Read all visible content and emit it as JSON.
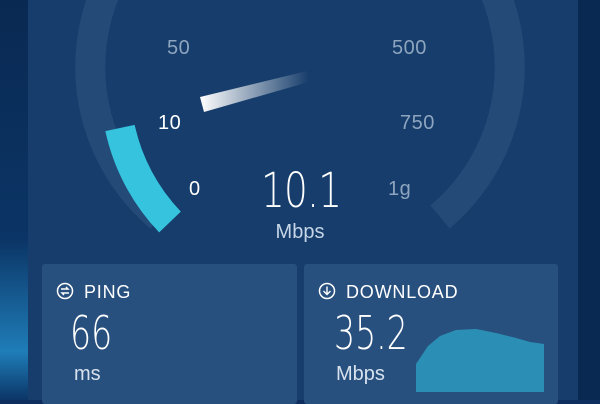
{
  "gauge": {
    "ticks": [
      {
        "label": "0"
      },
      {
        "label": "10"
      },
      {
        "label": "50"
      },
      {
        "label": "500"
      },
      {
        "label": "750"
      },
      {
        "label": "1g"
      }
    ],
    "current_value": "10.1",
    "unit": "Mbps",
    "fill_fraction": 0.2,
    "colors": {
      "track": "#244b78",
      "fill": "#35c3de",
      "needle": "#ffffff"
    }
  },
  "ping": {
    "title": "PING",
    "icon": "ping-icon",
    "value": "66",
    "unit": "ms"
  },
  "download": {
    "title": "DOWNLOAD",
    "icon": "download-arrow-icon",
    "value": "35.2",
    "unit": "Mbps",
    "graph_color": "#2b8fb5"
  }
}
